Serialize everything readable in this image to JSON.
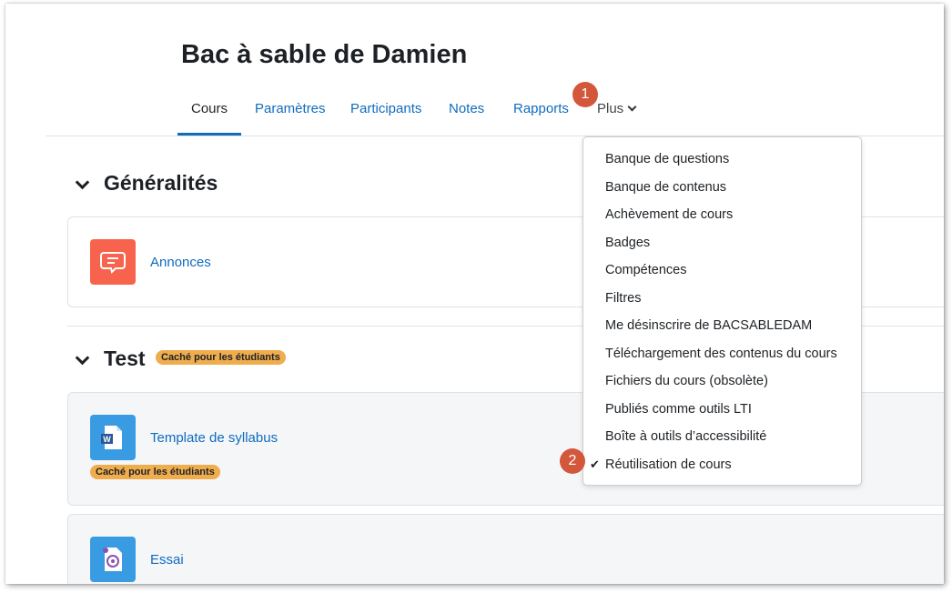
{
  "course": {
    "title": "Bac à sable de Damien"
  },
  "nav": {
    "tabs": [
      "Cours",
      "Paramètres",
      "Participants",
      "Notes",
      "Rapports"
    ],
    "more_label": "Plus"
  },
  "callouts": {
    "first": "1",
    "second": "2"
  },
  "sections": {
    "general": {
      "title": "Généralités",
      "activity": {
        "name": "Annonces",
        "icon": "forum-icon",
        "icon_color": "#f7634d"
      }
    },
    "test": {
      "title": "Test",
      "badge": "Caché pour les étudiants",
      "activities": [
        {
          "name": "Template de syllabus",
          "icon": "word-document-icon",
          "icon_color": "#399be2",
          "badge": "Caché pour les étudiants"
        },
        {
          "name": "Essai",
          "icon": "assignment-icon",
          "icon_color": "#399be2"
        }
      ]
    }
  },
  "more_menu": {
    "items": [
      "Banque de questions",
      "Banque de contenus",
      "Achèvement de cours",
      "Badges",
      "Compétences",
      "Filtres",
      "Me désinscrire de BACSABLEDAM",
      "Téléchargement des contenus du cours",
      "Fichiers du cours (obsolète)",
      "Publiés comme outils LTI",
      "Boîte à outils d’accessibilité",
      "Réutilisation de cours"
    ],
    "selected": "Réutilisation de cours"
  },
  "colors": {
    "link": "#0f6cbf",
    "callout": "#d3573b",
    "badge": "#f0ad4e"
  }
}
